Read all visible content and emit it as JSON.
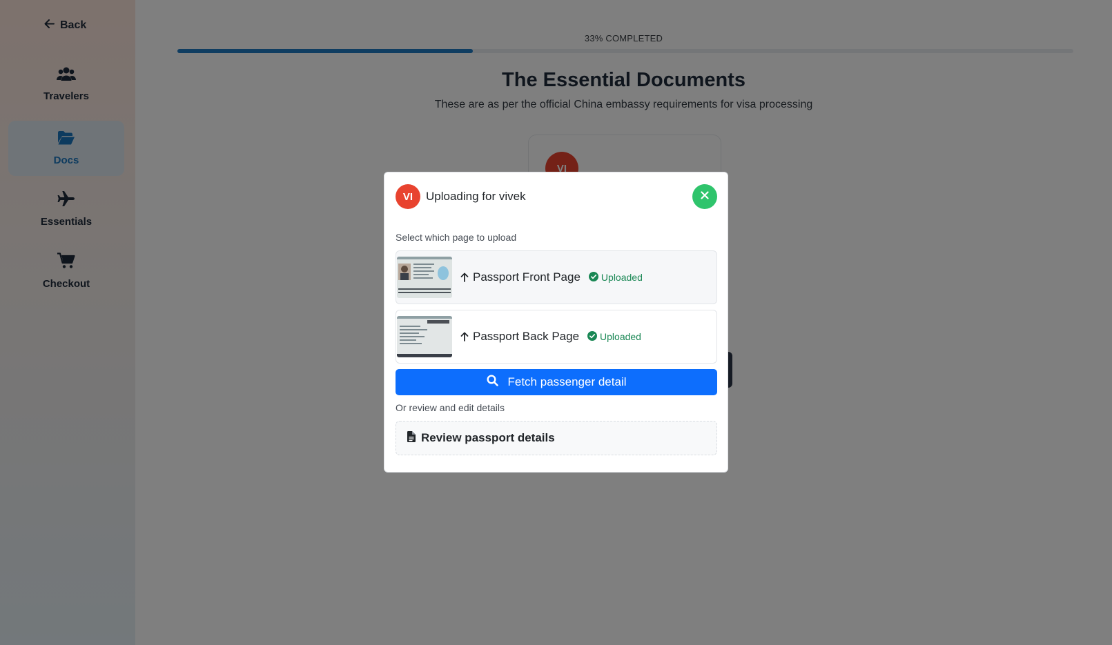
{
  "sidebar": {
    "back_label": "Back",
    "items": [
      {
        "label": "Travelers",
        "icon": "users-icon"
      },
      {
        "label": "Docs",
        "icon": "folder-open-icon",
        "active": true
      },
      {
        "label": "Essentials",
        "icon": "plane-icon"
      },
      {
        "label": "Checkout",
        "icon": "cart-icon"
      }
    ]
  },
  "main": {
    "progress_text": "33% COMPLETED",
    "progress_value": 0.33,
    "title": "The Essential Documents",
    "subtitle": "These are as per the official China embassy requirements for visa processing",
    "traveler_initials": "VI"
  },
  "modal": {
    "avatar_initials": "VI",
    "title": "Uploading for vivek",
    "select_label": "Select which page to upload",
    "pages": [
      {
        "title": "Passport Front Page",
        "status": "Uploaded"
      },
      {
        "title": "Passport Back Page",
        "status": "Uploaded"
      }
    ],
    "fetch_label": "Fetch passenger detail",
    "or_label": "Or review and edit details",
    "review_label": "Review passport details"
  },
  "colors": {
    "accent_blue": "#0d6efd",
    "progress_blue": "#1e7bc2",
    "success_green": "#198754",
    "close_green": "#2fc46c",
    "avatar_red": "#e8432f"
  }
}
